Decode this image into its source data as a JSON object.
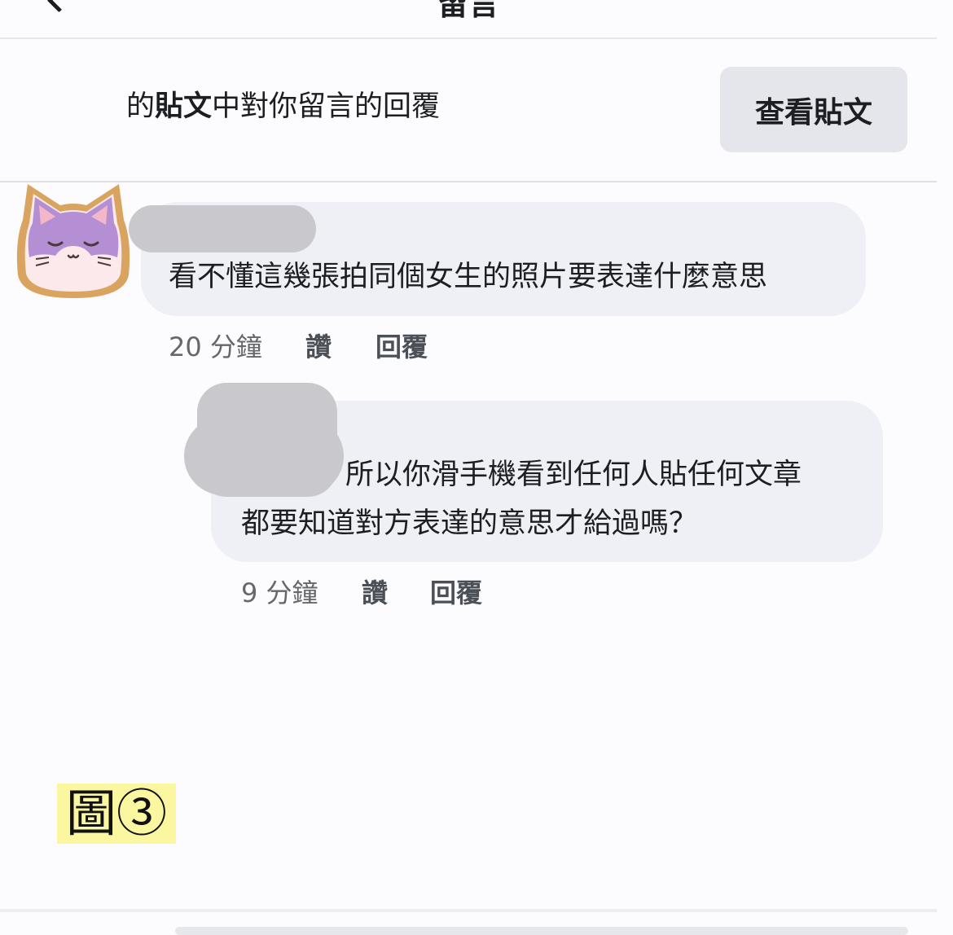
{
  "header": {
    "title": "留言"
  },
  "context": {
    "prefix": "的",
    "post_word": "貼文",
    "suffix": "中對你留言的回覆",
    "view_post_label": "查看貼文"
  },
  "comments": [
    {
      "text": "看不懂這幾張拍同個女生的照片要表達什麼意思",
      "time": "20 分鐘",
      "like_label": "讚",
      "reply_label": "回覆"
    },
    {
      "line1": "所以你滑手機看到任何人貼任何文章",
      "line2": "都要知道對方表達的意思才給過嗎？",
      "time": "9 分鐘",
      "like_label": "讚",
      "reply_label": "回覆"
    }
  ],
  "figure_label": "圖③",
  "colors": {
    "bubble": "#eef0f5",
    "button": "#e5e6eb",
    "label_highlight": "#fbf7a0",
    "redaction": "#c9c9cd"
  },
  "avatar_icon": "sleeping-cat-icon"
}
